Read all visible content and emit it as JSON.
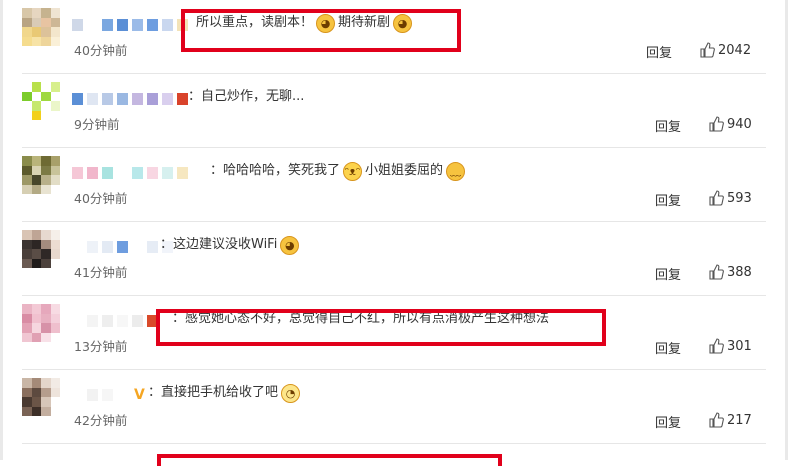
{
  "colors": {
    "highlight": "#e1001b",
    "separator": "#e6e6e6",
    "meta": "#666666"
  },
  "actions": {
    "reply_label": "回复"
  },
  "comments": [
    {
      "text_parts": [
        "所以重点，读剧本！",
        "期待新剧"
      ],
      "emojis": [
        "cat-emoji",
        "cat-emoji"
      ],
      "time": "40分钟前",
      "likes": "2042",
      "highlighted": true
    },
    {
      "text_parts": [
        "：自己炒作，无聊..."
      ],
      "emojis": [],
      "time": "9分钟前",
      "likes": "940",
      "highlighted": false
    },
    {
      "text_parts": [
        "：哈哈哈哈，笑死我了",
        "小姐姐委屈的"
      ],
      "emojis": [
        "laughing-crying-emoji",
        "wronged-emoji"
      ],
      "time": "40分钟前",
      "likes": "593",
      "highlighted": false
    },
    {
      "text_parts": [
        "：这边建议没收WiFi"
      ],
      "emojis": [
        "cat-emoji"
      ],
      "time": "41分钟前",
      "likes": "388",
      "highlighted": false
    },
    {
      "text_parts": [
        "：感觉她心态不好，总觉得自己不红，所以有点消极产生这种想法"
      ],
      "emojis": [],
      "time": "13分钟前",
      "likes": "301",
      "highlighted": true
    },
    {
      "text_parts": [
        "：直接把手机给收了吧"
      ],
      "emojis": [
        "sweat-emoji"
      ],
      "time": "42分钟前",
      "likes": "217",
      "highlighted": false
    }
  ]
}
